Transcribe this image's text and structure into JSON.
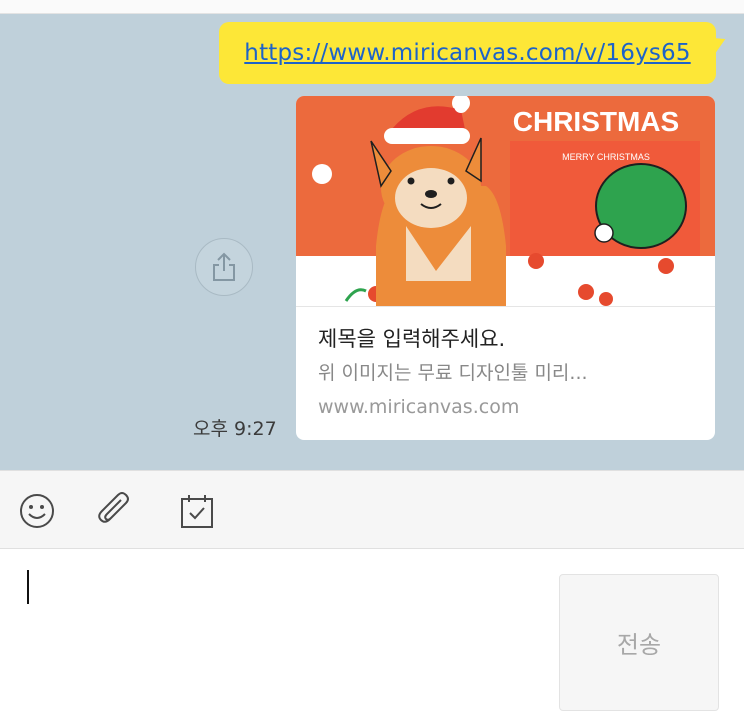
{
  "message": {
    "url": "https://www.miricanvas.com/v/16ys65",
    "time": "오후 9:27"
  },
  "preview": {
    "image_heading": "CHRISTMAS",
    "image_subheading": "MERRY CHRISTMAS",
    "title": "제목을 입력해주세요.",
    "description": "위 이미지는 무료 디자인툴 미리...",
    "domain": "www.miricanvas.com"
  },
  "toolbar": {
    "icons": [
      "emoji-icon",
      "paperclip-icon",
      "calendar-check-icon"
    ]
  },
  "composer": {
    "value": "",
    "send_label": "전송"
  },
  "colors": {
    "chat_bg": "#bfd0da",
    "bubble": "#fde737",
    "link": "#1d63c9",
    "card_orange": "#ec6a3d"
  }
}
